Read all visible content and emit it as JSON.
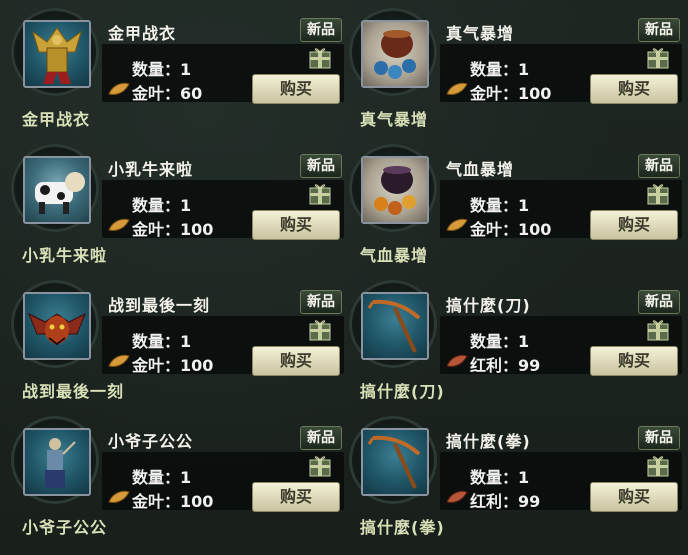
{
  "items": [
    {
      "name": "金甲战衣",
      "caption": "金甲战衣",
      "quantity_label": "数量：1",
      "price_label": "金叶：60",
      "currency": "金叶",
      "currency_icon": "gold-leaf-icon",
      "new_badge": "新品",
      "buy_label": "购买",
      "icon": "golden-armor-icon"
    },
    {
      "name": "真气暴增",
      "caption": "真气暴增",
      "quantity_label": "数量：1",
      "price_label": "金叶：100",
      "currency": "金叶",
      "currency_icon": "gold-leaf-icon",
      "new_badge": "新品",
      "buy_label": "购买",
      "icon": "blue-pill-jar-icon"
    },
    {
      "name": "小乳牛来啦",
      "caption": "小乳牛来啦",
      "quantity_label": "数量：1",
      "price_label": "金叶：100",
      "currency": "金叶",
      "currency_icon": "gold-leaf-icon",
      "new_badge": "新品",
      "buy_label": "购买",
      "icon": "cow-pet-icon"
    },
    {
      "name": "气血暴增",
      "caption": "气血暴增",
      "quantity_label": "数量：1",
      "price_label": "金叶：100",
      "currency": "金叶",
      "currency_icon": "gold-leaf-icon",
      "new_badge": "新品",
      "buy_label": "购买",
      "icon": "orange-pill-jar-icon"
    },
    {
      "name": "战到最後一刻",
      "caption": "战到最後一刻",
      "quantity_label": "数量：1",
      "price_label": "金叶：100",
      "currency": "金叶",
      "currency_icon": "gold-leaf-icon",
      "new_badge": "新品",
      "buy_label": "购买",
      "icon": "demon-mask-icon"
    },
    {
      "name": "搞什麼(刀)",
      "caption": "搞什麼(刀)",
      "quantity_label": "数量：1",
      "price_label": "红利：99",
      "currency": "红利",
      "currency_icon": "red-leaf-icon",
      "new_badge": "新品",
      "buy_label": "购买",
      "icon": "pickaxe-icon"
    },
    {
      "name": "小爷子公公",
      "caption": "小爷子公公",
      "quantity_label": "数量：1",
      "price_label": "金叶：100",
      "currency": "金叶",
      "currency_icon": "gold-leaf-icon",
      "new_badge": "新品",
      "buy_label": "购买",
      "icon": "eunuch-figure-icon"
    },
    {
      "name": "搞什麼(拳)",
      "caption": "搞什麼(拳)",
      "quantity_label": "数量：1",
      "price_label": "红利：99",
      "currency": "红利",
      "currency_icon": "red-leaf-icon",
      "new_badge": "新品",
      "buy_label": "购买",
      "icon": "pickaxe-icon"
    }
  ],
  "colors": {
    "background": "#1c231f",
    "badge_bg": "#2c3a2c",
    "buy_button": "#e6e2c4",
    "caption_text": "#d8e0b8",
    "gold_leaf": "#d59a3a",
    "red_leaf": "#b5553a"
  }
}
